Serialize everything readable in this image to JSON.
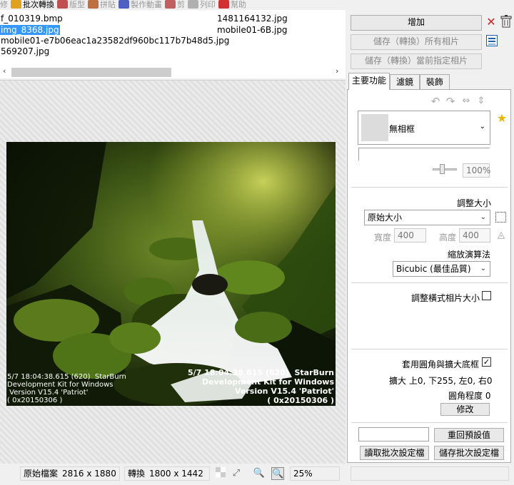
{
  "menu": {
    "items": [
      {
        "label": "修",
        "icon": "cut-icon",
        "color": "#b0b0b0",
        "active": false
      },
      {
        "label": "批次轉換",
        "icon": "batch-convert-icon",
        "color": "#e0a020",
        "active": true
      },
      {
        "label": "版型",
        "icon": "layout-icon",
        "color": "#c05050",
        "active": false
      },
      {
        "label": "拼貼",
        "icon": "collage-icon",
        "color": "#c07040",
        "active": false
      },
      {
        "label": "製作動畫",
        "icon": "animation-icon",
        "color": "#5060c0",
        "active": false
      },
      {
        "label": "剪",
        "icon": "trim-icon",
        "color": "#c06060",
        "active": false
      },
      {
        "label": "列印",
        "icon": "print-icon",
        "color": "#b0b0b0",
        "active": false
      },
      {
        "label": "幫助",
        "icon": "help-icon",
        "color": "#d03030",
        "active": false
      }
    ]
  },
  "files": [
    {
      "name": "f_010319.bmp",
      "selected": false
    },
    {
      "name": "1481164132.jpg",
      "selected": false
    },
    {
      "name": "img_8368.jpg",
      "selected": true
    },
    {
      "name": "mobile01-6B.jpg",
      "selected": false
    },
    {
      "name": "mobile01-e7b06eac1a23582df960bc117b7b48d5.jpg",
      "selected": false
    },
    {
      "name": "569207.jpg",
      "selected": false
    }
  ],
  "scroll": {
    "left": "‹",
    "right": "›"
  },
  "photo": {
    "caption_left": "5/7 18:04:38.615 (620)  StarBurn\nDevelopment Kit for Windows\n Version V15.4 'Patriot'\n( 0x20150306 )",
    "caption_right": "5/7 18:04:38.615 (620)  StarBurn\nDevelopment Kit for Windows\nVersion V15.4 'Patriot'\n( 0x20150306 )"
  },
  "status": {
    "original_label": "原始檔案",
    "original_size": "2816 x 1880",
    "convert_label": "轉換",
    "convert_size": "1800 x 1442",
    "zoom": "25%"
  },
  "buttons": {
    "add": "增加",
    "save_all": "儲存（轉換）所有相片",
    "save_selected": "儲存（轉換）當前指定相片",
    "modify": "修改",
    "reset_default": "重回預設值",
    "load_batch": "讀取批次設定檔",
    "save_batch": "儲存批次設定檔"
  },
  "tabs": [
    "主要功能",
    "濾鏡",
    "裝飾"
  ],
  "frame": {
    "selected": "無相框",
    "opacity": "100%"
  },
  "resize": {
    "title": "調整大小",
    "mode": "原始大小",
    "width_label": "寬度",
    "width_value": "400",
    "height_label": "高度",
    "height_value": "400",
    "algorithm_label": "縮放演算法",
    "algorithm": "Bicubic (最佳品質)",
    "landscape_label": "調整橫式相片大小"
  },
  "corner": {
    "apply_label": "套用圓角與擴大底框",
    "expand_label": "擴大",
    "expand_values": "上0, 下255, 左0, 右0",
    "radius_label": "圓角程度",
    "radius_value": "0"
  },
  "colors": {
    "selection": "#3399ff",
    "delete": "#cc2222",
    "star": "#e8b400"
  }
}
